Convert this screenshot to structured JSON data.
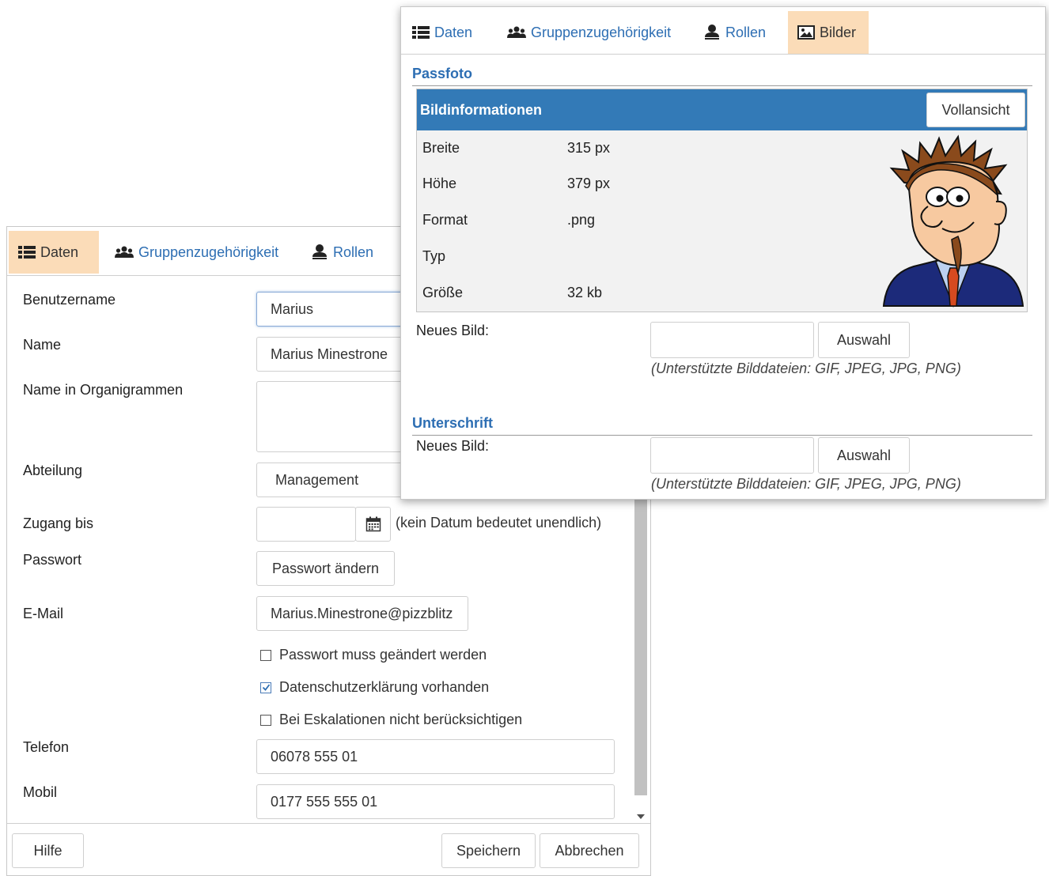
{
  "back_dialog": {
    "tabs": [
      {
        "label": "Daten",
        "icon": "list-icon",
        "active": true
      },
      {
        "label": "Gruppenzugehörigkeit",
        "icon": "users-icon",
        "active": false
      },
      {
        "label": "Rollen",
        "icon": "user-icon",
        "active": false
      }
    ],
    "fields": {
      "username": {
        "label": "Benutzername",
        "value": "Marius"
      },
      "name": {
        "label": "Name",
        "value": "Marius Minestrone"
      },
      "org_name": {
        "label": "Name in Organigrammen",
        "value": ""
      },
      "department": {
        "label": "Abteilung",
        "value": "Management"
      },
      "access_until": {
        "label": "Zugang bis",
        "value": "",
        "hint": "(kein Datum bedeutet unendlich)"
      },
      "password": {
        "label": "Passwort",
        "button": "Passwort ändern"
      },
      "email": {
        "label": "E-Mail",
        "value": "Marius.Minestrone@pizzblitz"
      },
      "phone": {
        "label": "Telefon",
        "value": "06078 555 01"
      },
      "mobile": {
        "label": "Mobil",
        "value": "0177 555 555 01"
      }
    },
    "checkboxes": [
      {
        "label": "Passwort muss geändert werden",
        "checked": false
      },
      {
        "label": "Datenschutzerklärung vorhanden",
        "checked": true
      },
      {
        "label": "Bei Eskalationen nicht berücksichtigen",
        "checked": false
      }
    ],
    "footer": {
      "help": "Hilfe",
      "save": "Speichern",
      "cancel": "Abbrechen"
    }
  },
  "front_dialog": {
    "tabs": [
      {
        "label": "Daten",
        "icon": "list-icon",
        "active": false
      },
      {
        "label": "Gruppenzugehörigkeit",
        "icon": "users-icon",
        "active": false
      },
      {
        "label": "Rollen",
        "icon": "user-icon",
        "active": false
      },
      {
        "label": "Bilder",
        "icon": "image-icon",
        "active": true
      }
    ],
    "passfoto": {
      "title": "Passfoto",
      "panel_title": "Bildinformationen",
      "fullview_button": "Vollansicht",
      "rows": [
        {
          "label": "Breite",
          "value": "315 px"
        },
        {
          "label": "Höhe",
          "value": "379 px"
        },
        {
          "label": "Format",
          "value": ".png"
        },
        {
          "label": "Typ",
          "value": ""
        },
        {
          "label": "Größe",
          "value": "32 kb"
        }
      ],
      "new_image_label": "Neues Bild:",
      "select_button": "Auswahl",
      "hint": "(Unterstützte Bilddateien: GIF, JPEG, JPG, PNG)"
    },
    "signature": {
      "title": "Unterschrift",
      "new_image_label": "Neues Bild:",
      "select_button": "Auswahl",
      "hint": "(Unterstützte Bilddateien: GIF, JPEG, JPG, PNG)"
    }
  },
  "colors": {
    "accent": "#337ab7",
    "link": "#2d6eb3",
    "active_tab": "#fbdcb8"
  }
}
